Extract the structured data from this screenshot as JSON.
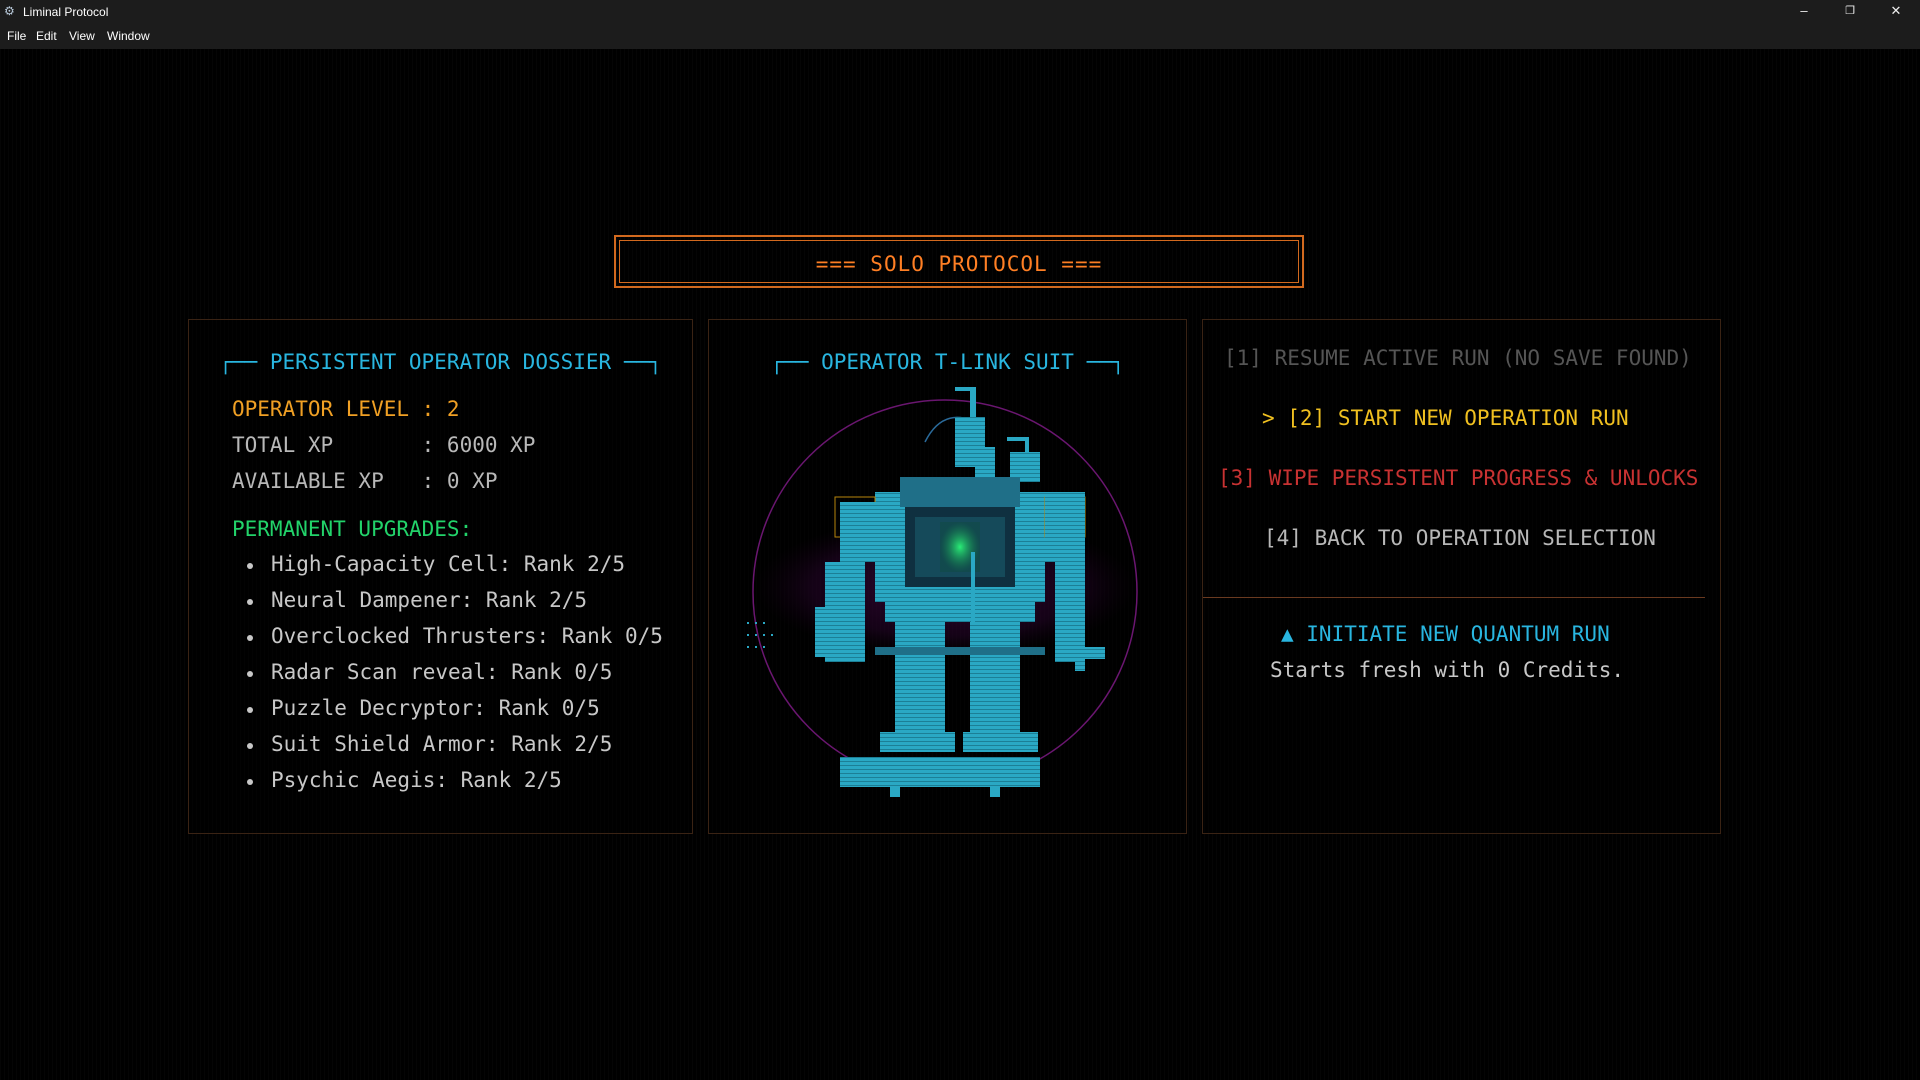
{
  "window": {
    "title": "Liminal Protocol",
    "minimize": "–",
    "restore": "❐",
    "close": "✕"
  },
  "menubar": [
    "File",
    "Edit",
    "View",
    "Window"
  ],
  "header": {
    "title": "=== SOLO PROTOCOL ==="
  },
  "dossier": {
    "heading_left": "┌── ",
    "heading": "PERSISTENT OPERATOR DOSSIER",
    "heading_right": " ──┐",
    "level": "OPERATOR LEVEL : 2",
    "total_xp": "TOTAL XP       : 6000 XP",
    "available_xp": "AVAILABLE XP   : 0 XP",
    "upgrades_title": "PERMANENT UPGRADES:",
    "upgrades": [
      "High-Capacity Cell: Rank 2/5",
      "Neural Dampener: Rank 2/5",
      "Overclocked Thrusters: Rank 0/5",
      "Radar Scan reveal: Rank 0/5",
      "Puzzle Decryptor: Rank 0/5",
      "Suit Shield Armor: Rank 2/5",
      "Psychic Aegis: Rank 2/5"
    ]
  },
  "suit": {
    "heading_left": "┌── ",
    "heading": "OPERATOR T-LINK SUIT",
    "heading_right": " ──┐"
  },
  "menu": {
    "options": [
      {
        "label": "[1] RESUME ACTIVE RUN (NO SAVE FOUND)",
        "state": "disabled"
      },
      {
        "label": "> [2] START NEW OPERATION RUN",
        "state": "selected"
      },
      {
        "label": "[3] WIPE PERSISTENT PROGRESS & UNLOCKS",
        "state": "danger"
      },
      {
        "label": "[4] BACK TO OPERATION SELECTION",
        "state": "normal"
      }
    ],
    "info_title": "▲ INITIATE NEW QUANTUM RUN",
    "info_desc": "Starts fresh with 0 Credits."
  },
  "colors": {
    "accent_cyan": "#29b6e0",
    "accent_orange": "#ff7f24",
    "selected_yellow": "#f0c020",
    "danger_red": "#c83232",
    "upgrade_green": "#22d36a",
    "disabled_grey": "#555555"
  }
}
